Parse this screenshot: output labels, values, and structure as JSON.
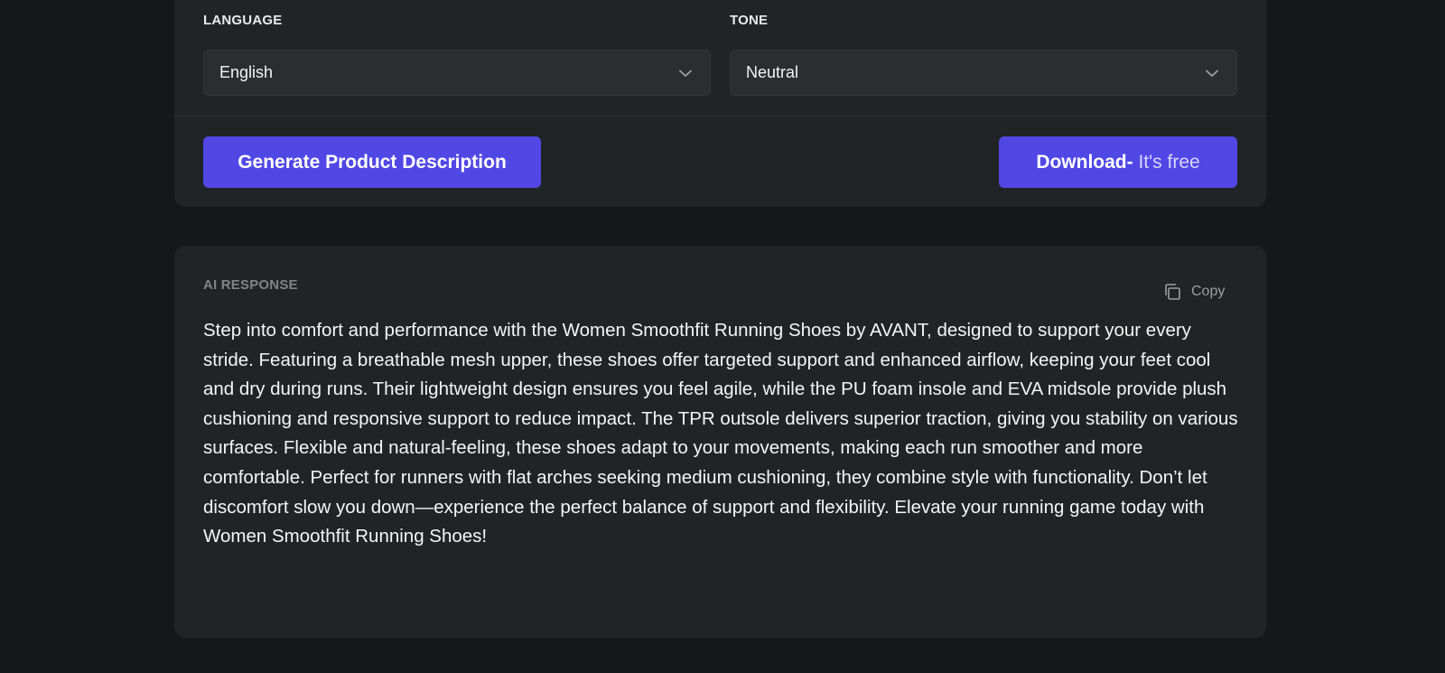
{
  "form": {
    "language": {
      "label": "LANGUAGE",
      "value": "English",
      "icon": "chevron-down-icon"
    },
    "tone": {
      "label": "TONE",
      "value": "Neutral",
      "icon": "chevron-down-icon"
    }
  },
  "actions": {
    "generate_label": "Generate Product Description",
    "download_label": "Download-",
    "download_free": " It's free"
  },
  "response": {
    "label": "AI RESPONSE",
    "copy_label": "Copy",
    "copy_icon": "copy-icon",
    "text": "Step into comfort and performance with the Women Smoothfit Running Shoes by AVANT, designed to support your every stride. Featuring a breathable mesh upper, these shoes offer targeted support and enhanced airflow, keeping your feet cool and dry during runs. Their lightweight design ensures you feel agile, while the PU foam insole and EVA midsole provide plush cushioning and responsive support to reduce impact. The TPR outsole delivers superior traction, giving you stability on various surfaces. Flexible and natural-feeling, these shoes adapt to your movements, making each run smoother and more comfortable. Perfect for runners with flat arches seeking medium cushioning, they combine style with functionality. Don’t let discomfort slow you down—experience the perfect balance of support and flexibility. Elevate your running game today with Women Smoothfit Running Shoes!"
  },
  "colors": {
    "background": "#15181a",
    "card": "#212426",
    "accent": "#5147e5"
  }
}
